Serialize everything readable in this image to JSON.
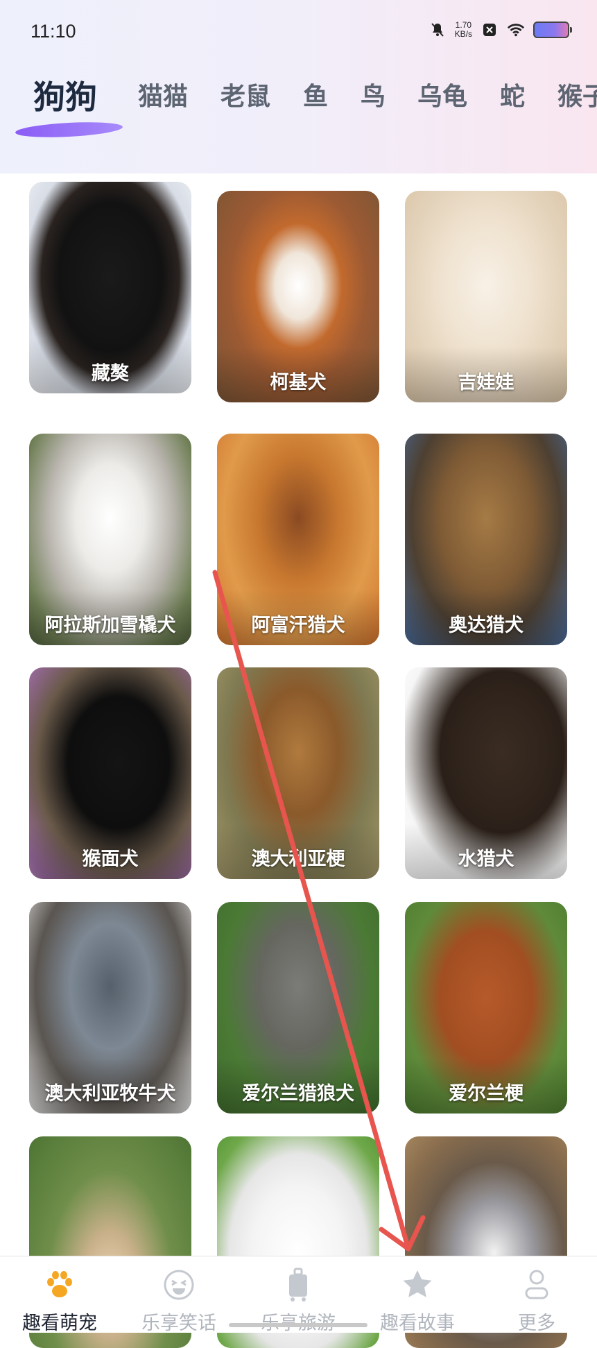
{
  "status_bar": {
    "time": "11:10",
    "net_speed_value": "1.70",
    "net_speed_unit": "KB/s"
  },
  "tabs": [
    {
      "label": "狗狗",
      "active": true
    },
    {
      "label": "猫猫",
      "active": false
    },
    {
      "label": "老鼠",
      "active": false
    },
    {
      "label": "鱼",
      "active": false
    },
    {
      "label": "鸟",
      "active": false
    },
    {
      "label": "乌龟",
      "active": false
    },
    {
      "label": "蛇",
      "active": false
    },
    {
      "label": "猴子",
      "active": false
    }
  ],
  "cards": [
    {
      "label": "藏獒"
    },
    {
      "label": "柯基犬"
    },
    {
      "label": "吉娃娃"
    },
    {
      "label": "阿拉斯加雪橇犬"
    },
    {
      "label": "阿富汗猎犬"
    },
    {
      "label": "奥达猎犬"
    },
    {
      "label": "猴面犬"
    },
    {
      "label": "澳大利亚梗"
    },
    {
      "label": "水猎犬"
    },
    {
      "label": "澳大利亚牧牛犬"
    },
    {
      "label": "爱尔兰猎狼犬"
    },
    {
      "label": "爱尔兰梗"
    },
    {
      "label": ""
    },
    {
      "label": ""
    },
    {
      "label": ""
    }
  ],
  "bottom_nav": [
    {
      "label": "趣看萌宠",
      "icon": "paw-icon",
      "active": true
    },
    {
      "label": "乐享笑话",
      "icon": "smile-icon",
      "active": false
    },
    {
      "label": "乐享旅游",
      "icon": "luggage-icon",
      "active": false
    },
    {
      "label": "趣看故事",
      "icon": "star-icon",
      "active": false
    },
    {
      "label": "更多",
      "icon": "user-icon",
      "active": false
    }
  ],
  "colors": {
    "accent": "#f5a623",
    "tab_active": "#1d2a3f",
    "tab_inactive": "#5d6472",
    "underline": "#8b5cf6",
    "annotation": "#e8554e"
  }
}
